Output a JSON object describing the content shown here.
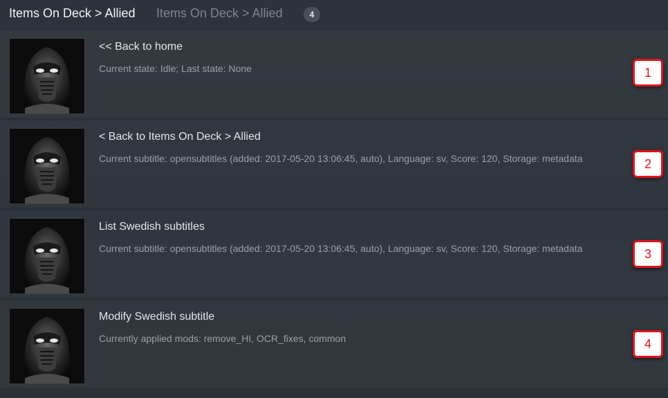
{
  "header": {
    "title": "Items On Deck > Allied",
    "subtitle": "Items On Deck > Allied",
    "count": "4"
  },
  "items": [
    {
      "title": "<< Back to home",
      "description": "Current state: Idle; Last state: None",
      "badge": "1",
      "thumbnail_icon": "masked-warrior-thumbnail"
    },
    {
      "title": "< Back to Items On Deck > Allied",
      "description": "Current subtitle: opensubtitles (added: 2017-05-20 13:06:45, auto), Language: sv, Score: 120, Storage: metadata",
      "badge": "2",
      "thumbnail_icon": "masked-warrior-thumbnail"
    },
    {
      "title": "List Swedish subtitles",
      "description": "Current subtitle: opensubtitles (added: 2017-05-20 13:06:45, auto), Language: sv, Score: 120, Storage: metadata",
      "badge": "3",
      "thumbnail_icon": "masked-warrior-thumbnail"
    },
    {
      "title": "Modify Swedish subtitle",
      "description": "Currently applied mods: remove_HI, OCR_fixes, common",
      "badge": "4",
      "thumbnail_icon": "masked-warrior-thumbnail"
    }
  ],
  "colors": {
    "badge_border": "#e0151c",
    "background": "#2b3038"
  }
}
